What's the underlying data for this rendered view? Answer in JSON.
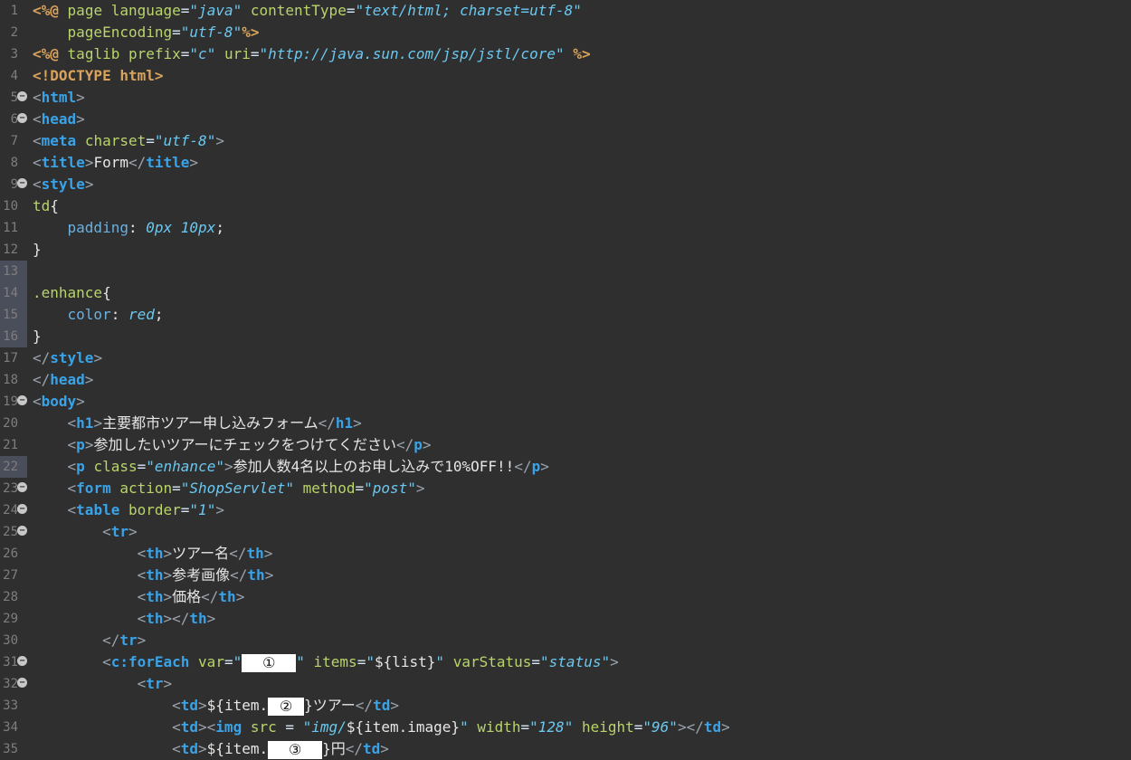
{
  "editor": {
    "lines": [
      {
        "n": "1",
        "fold": false,
        "mark": false,
        "html": "<span class='jsp'>&lt;%@</span> <span class='attr'>page language</span>=<span class='val'>\"java\"</span> <span class='attr'>contentType</span>=<span class='val'>\"text/html; charset=utf-8\"</span>"
      },
      {
        "n": "2",
        "fold": false,
        "mark": false,
        "html": "    <span class='attr'>pageEncoding</span>=<span class='val'>\"utf-8\"</span><span class='jsp'>%&gt;</span>"
      },
      {
        "n": "3",
        "fold": false,
        "mark": false,
        "html": "<span class='jsp'>&lt;%@</span> <span class='attr'>taglib prefix</span>=<span class='val'>\"c\"</span> <span class='attr'>uri</span>=<span class='val'>\"http://java.sun.com/jsp/jstl/core\"</span> <span class='jsp'>%&gt;</span>"
      },
      {
        "n": "4",
        "fold": false,
        "mark": false,
        "html": "<span class='jsp'>&lt;!DOCTYPE html&gt;</span>"
      },
      {
        "n": "5",
        "fold": true,
        "mark": false,
        "html": "<span class='br'>&lt;</span><span class='tag'>html</span><span class='br'>&gt;</span>"
      },
      {
        "n": "6",
        "fold": true,
        "mark": false,
        "html": "<span class='br'>&lt;</span><span class='tag'>head</span><span class='br'>&gt;</span>"
      },
      {
        "n": "7",
        "fold": false,
        "mark": false,
        "html": "<span class='br'>&lt;</span><span class='tag'>meta</span> <span class='attr'>charset</span>=<span class='val'>\"utf-8\"</span><span class='br'>&gt;</span>"
      },
      {
        "n": "8",
        "fold": false,
        "mark": false,
        "html": "<span class='br'>&lt;</span><span class='tag'>title</span><span class='br'>&gt;</span><span class='txt'>Form</span><span class='br'>&lt;/</span><span class='tag'>title</span><span class='br'>&gt;</span>"
      },
      {
        "n": "9",
        "fold": true,
        "mark": false,
        "html": "<span class='br'>&lt;</span><span class='tag'>style</span><span class='br'>&gt;</span>"
      },
      {
        "n": "10",
        "fold": false,
        "mark": false,
        "html": "<span class='cssk'>td</span><span class='txt'>{</span>"
      },
      {
        "n": "11",
        "fold": false,
        "mark": false,
        "html": "    <span class='attr' style='color:#6ab0e0'>padding</span><span class='txt'>:</span> <span class='val'>0px 10px</span><span class='txt'>;</span>"
      },
      {
        "n": "12",
        "fold": false,
        "mark": false,
        "html": "<span class='txt'>}</span>"
      },
      {
        "n": "13",
        "fold": false,
        "mark": true,
        "html": ""
      },
      {
        "n": "14",
        "fold": false,
        "mark": true,
        "html": "<span class='cssk'>.enhance</span><span class='txt'>{</span>"
      },
      {
        "n": "15",
        "fold": false,
        "mark": true,
        "html": "    <span class='attr' style='color:#6ab0e0'>color</span><span class='txt'>:</span> <span class='val'>red</span><span class='txt'>;</span>"
      },
      {
        "n": "16",
        "fold": false,
        "mark": true,
        "html": "<span class='txt'>}</span>"
      },
      {
        "n": "17",
        "fold": false,
        "mark": false,
        "html": "<span class='br'>&lt;/</span><span class='tag'>style</span><span class='br'>&gt;</span>"
      },
      {
        "n": "18",
        "fold": false,
        "mark": false,
        "html": "<span class='br'>&lt;/</span><span class='tag'>head</span><span class='br'>&gt;</span>"
      },
      {
        "n": "19",
        "fold": true,
        "mark": false,
        "html": "<span class='br'>&lt;</span><span class='tag'>body</span><span class='br'>&gt;</span>"
      },
      {
        "n": "20",
        "fold": false,
        "mark": false,
        "html": "    <span class='br'>&lt;</span><span class='tag'>h1</span><span class='br'>&gt;</span><span class='txt'>主要都市ツアー申し込みフォーム</span><span class='br'>&lt;/</span><span class='tag'>h1</span><span class='br'>&gt;</span>"
      },
      {
        "n": "21",
        "fold": false,
        "mark": false,
        "html": "    <span class='br'>&lt;</span><span class='tag'>p</span><span class='br'>&gt;</span><span class='txt'>参加したいツアーにチェックをつけてください</span><span class='br'>&lt;/</span><span class='tag'>p</span><span class='br'>&gt;</span>"
      },
      {
        "n": "22",
        "fold": false,
        "mark": true,
        "html": "    <span class='br'>&lt;</span><span class='tag'>p</span> <span class='attr'>class</span>=<span class='val'>\"enhance\"</span><span class='br'>&gt;</span><span class='txt'>参加人数4名以上のお申し込みで10%OFF!!</span><span class='br'>&lt;/</span><span class='tag'>p</span><span class='br'>&gt;</span>"
      },
      {
        "n": "23",
        "fold": true,
        "mark": false,
        "html": "    <span class='br'>&lt;</span><span class='tag'>form</span> <span class='attr'>action</span>=<span class='val'>\"ShopServlet\"</span> <span class='attr'>method</span>=<span class='val'>\"post\"</span><span class='br'>&gt;</span>"
      },
      {
        "n": "24",
        "fold": true,
        "mark": false,
        "html": "    <span class='br'>&lt;</span><span class='tag'>table</span> <span class='attr'>border</span>=<span class='val'>\"1\"</span><span class='br'>&gt;</span>"
      },
      {
        "n": "25",
        "fold": true,
        "mark": false,
        "html": "        <span class='br'>&lt;</span><span class='tag'>tr</span><span class='br'>&gt;</span>"
      },
      {
        "n": "26",
        "fold": false,
        "mark": false,
        "html": "            <span class='br'>&lt;</span><span class='tag'>th</span><span class='br'>&gt;</span><span class='txt'>ツアー名</span><span class='br'>&lt;/</span><span class='tag'>th</span><span class='br'>&gt;</span>"
      },
      {
        "n": "27",
        "fold": false,
        "mark": false,
        "html": "            <span class='br'>&lt;</span><span class='tag'>th</span><span class='br'>&gt;</span><span class='txt'>参考画像</span><span class='br'>&lt;/</span><span class='tag'>th</span><span class='br'>&gt;</span>"
      },
      {
        "n": "28",
        "fold": false,
        "mark": false,
        "html": "            <span class='br'>&lt;</span><span class='tag'>th</span><span class='br'>&gt;</span><span class='txt'>価格</span><span class='br'>&lt;/</span><span class='tag'>th</span><span class='br'>&gt;</span>"
      },
      {
        "n": "29",
        "fold": false,
        "mark": false,
        "html": "            <span class='br'>&lt;</span><span class='tag'>th</span><span class='br'>&gt;&lt;/</span><span class='tag'>th</span><span class='br'>&gt;</span>"
      },
      {
        "n": "30",
        "fold": false,
        "mark": false,
        "html": "        <span class='br'>&lt;/</span><span class='tag'>tr</span><span class='br'>&gt;</span>"
      },
      {
        "n": "31",
        "fold": true,
        "mark": false,
        "html": "        <span class='br'>&lt;</span><span class='tag'>c:forEach</span> <span class='attr'>var</span>=<span class='val'>\"<span class='blank' style='width:60px'>①</span>\"</span> <span class='attr'>items</span>=<span class='val'>\"</span><span class='txt'>${list}</span><span class='val'>\"</span> <span class='attr'>varStatus</span>=<span class='val'>\"status\"</span><span class='br'>&gt;</span>"
      },
      {
        "n": "32",
        "fold": true,
        "mark": false,
        "html": "            <span class='br'>&lt;</span><span class='tag'>tr</span><span class='br'>&gt;</span>"
      },
      {
        "n": "33",
        "fold": false,
        "mark": false,
        "html": "                <span class='br'>&lt;</span><span class='tag'>td</span><span class='br'>&gt;</span><span class='txt'>${item.<span class='blank' style='width:40px'>②</span>}ツアー</span><span class='br'>&lt;/</span><span class='tag'>td</span><span class='br'>&gt;</span>"
      },
      {
        "n": "34",
        "fold": false,
        "mark": false,
        "html": "                <span class='br'>&lt;</span><span class='tag'>td</span><span class='br'>&gt;&lt;</span><span class='tag'>img</span> <span class='attr'>src</span> = <span class='val'>\"img/</span><span class='txt'>${item.image}</span><span class='val'>\"</span> <span class='attr'>width</span>=<span class='val'>\"128\"</span> <span class='attr'>height</span>=<span class='val'>\"96\"</span><span class='br'>&gt;&lt;/</span><span class='tag'>td</span><span class='br'>&gt;</span>"
      },
      {
        "n": "35",
        "fold": false,
        "mark": false,
        "html": "                <span class='br'>&lt;</span><span class='tag'>td</span><span class='br'>&gt;</span><span class='txt'>${item.<span class='blank' style='width:60px'>③</span>}円</span><span class='br'>&lt;/</span><span class='tag'>td</span><span class='br'>&gt;</span>"
      }
    ]
  }
}
